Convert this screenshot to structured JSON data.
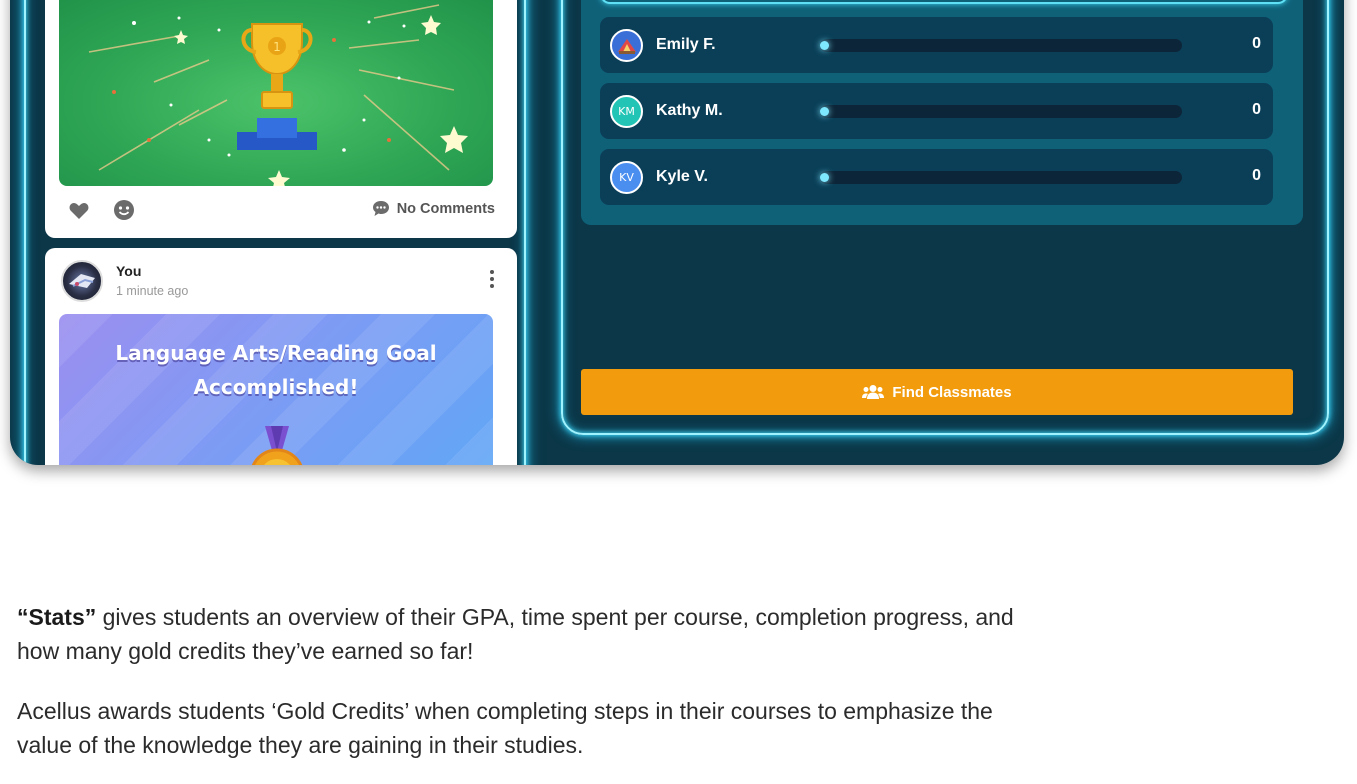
{
  "feed": {
    "post_1": {
      "comments_label": "No Comments",
      "icons": [
        "heart-icon",
        "smile-icon",
        "comment-icon"
      ]
    },
    "post_2": {
      "author": "You",
      "time": "1 minute ago",
      "goal_title_line1": "Language Arts/Reading Goal",
      "goal_title_line2": "Accomplished!"
    }
  },
  "leaderboard": {
    "rows": [
      {
        "initials": "",
        "avatar_type": "image",
        "name": "Emily F.",
        "score": "0",
        "progress": 0,
        "avatar_color": "#3b6fd8"
      },
      {
        "initials": "KM",
        "avatar_type": "initials",
        "name": "Kathy M.",
        "score": "0",
        "progress": 0,
        "avatar_color": "#22c4b5"
      },
      {
        "initials": "KV",
        "avatar_type": "initials",
        "name": "Kyle V.",
        "score": "0",
        "progress": 0,
        "avatar_color": "#4a8ef0"
      }
    ],
    "find_button_label": "Find Classmates"
  },
  "colors": {
    "frame_bg": "#0b3748",
    "neon": "#45e0ff",
    "panel": "#0f6178",
    "row_bg": "#0b3f58",
    "button": "#f29c0d"
  },
  "caption": {
    "p1_bold": "“Stats”",
    "p1_rest": " gives students an overview of their GPA, time spent per course, completion progress, and",
    "p1_line2": "how many gold credits they’ve earned so far!",
    "p2_line1": "Acellus awards students ‘Gold Credits’ when completing steps in their courses to emphasize the",
    "p2_line2": "value of the knowledge they are gaining in their studies."
  }
}
